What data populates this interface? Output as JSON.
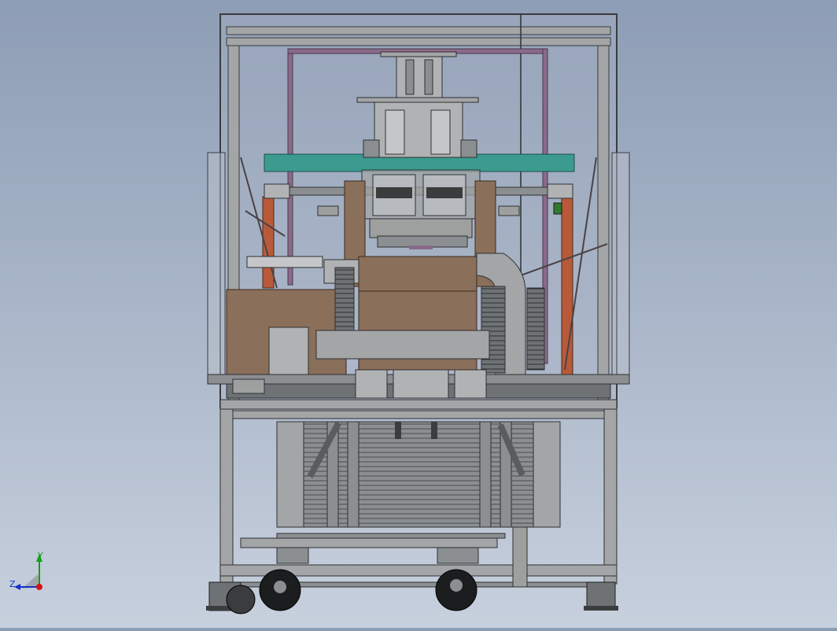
{
  "view": {
    "background_top": "#8d9db5",
    "background_bottom": "#c7d0dd",
    "frame_color": "#9ea0a0",
    "carton_color": "#8a6f5a",
    "panel_teal": "#3b9b8f",
    "rail_purple": "#8a6a8a",
    "accent_orange": "#b85a3a"
  },
  "axis_triad": {
    "y_label": "Y",
    "z_label": "Z",
    "y_color": "#14a014",
    "z_color": "#1432c8",
    "origin_color": "#d41414"
  }
}
